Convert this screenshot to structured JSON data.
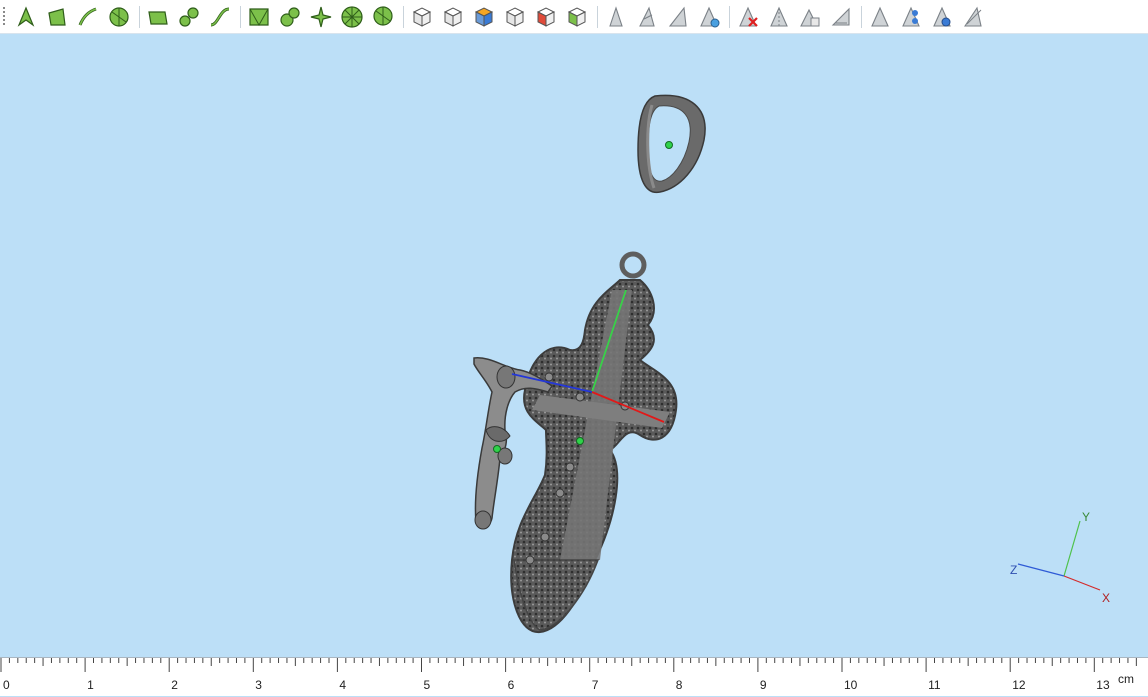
{
  "toolbar": {
    "groups": [
      [
        "select-arrow-icon",
        "select-face-icon",
        "select-edge-icon",
        "select-vertex-icon"
      ],
      [
        "plane-icon",
        "brush-icon",
        "curve-icon"
      ],
      [
        "mesh-icon",
        "sculpt-icon",
        "pattern-icon",
        "radial-icon",
        "lasso-icon"
      ],
      [
        "cube-view-icon",
        "cube-top-icon",
        "cube-color-icon",
        "cube-wire-icon",
        "cube-section-icon",
        "cube-grid-icon"
      ],
      [
        "shape-icon",
        "shape-cut-icon",
        "shape-fold-icon",
        "shape-paint-icon"
      ],
      [
        "delete-shape-icon",
        "slice-icon",
        "copy-shape-icon",
        "plane-shape-icon"
      ],
      [
        "visibility-icon",
        "visibility-stack-icon",
        "visibility-eye-icon",
        "hide-icon"
      ]
    ]
  },
  "viewport": {
    "background": "#bcdff7",
    "axis_labels": {
      "x": "X",
      "y": "Y",
      "z": "Z"
    }
  },
  "ruler": {
    "unit": "cm",
    "labels": [
      "0",
      "1",
      "2",
      "3",
      "4",
      "5",
      "6",
      "7",
      "8",
      "9",
      "10",
      "11",
      "12",
      "13"
    ]
  }
}
